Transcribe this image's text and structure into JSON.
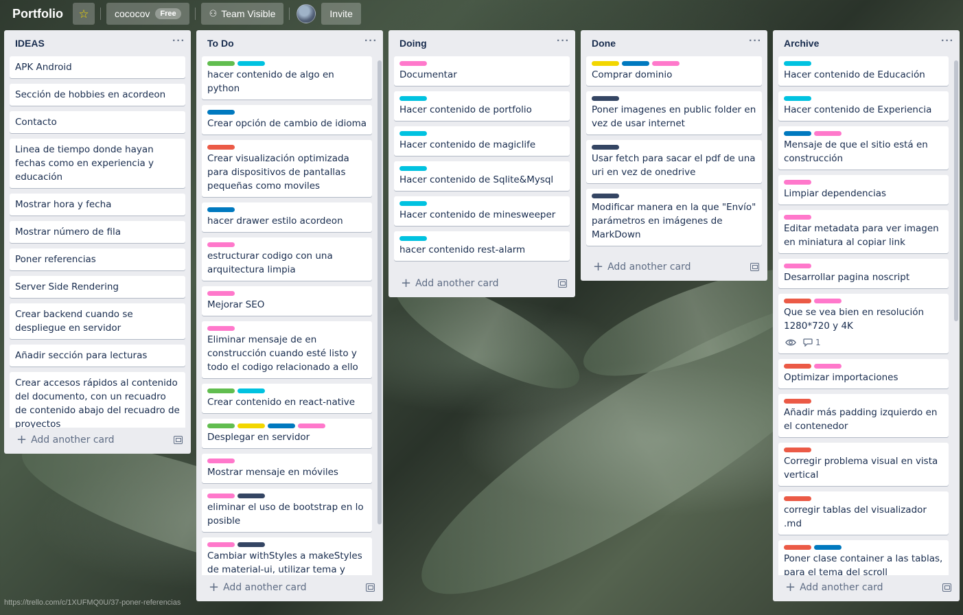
{
  "header": {
    "board_title": "Portfolio",
    "workspace": "cococov",
    "plan_badge": "Free",
    "visibility": "Team Visible",
    "invite": "Invite"
  },
  "colors": {
    "green": "#61bd4f",
    "yellow": "#f2d600",
    "red": "#eb5a46",
    "blue": "#0079bf",
    "sky": "#00c2e0",
    "pink": "#ff78cb",
    "navy": "#344563"
  },
  "add_card_label": "Add another card",
  "status_url": "https://trello.com/c/1XUFMQ0U/37-poner-referencias",
  "lists": [
    {
      "title": "IDEAS",
      "cards": [
        {
          "text": "APK Android",
          "labels": []
        },
        {
          "text": "Sección de hobbies en acordeon",
          "labels": []
        },
        {
          "text": "Contacto",
          "labels": []
        },
        {
          "text": "Linea de tiempo donde hayan fechas como en experiencia y educación",
          "labels": []
        },
        {
          "text": "Mostrar hora y fecha",
          "labels": []
        },
        {
          "text": "Mostrar número de fila",
          "labels": []
        },
        {
          "text": "Poner referencias",
          "labels": []
        },
        {
          "text": "Server Side Rendering",
          "labels": []
        },
        {
          "text": "Crear backend cuando se despliegue en servidor",
          "labels": []
        },
        {
          "text": "Añadir sección para lecturas",
          "labels": []
        },
        {
          "text": "Crear accesos rápidos al contenido del documento, con un recuadro de contenido abajo del recuadro de proyectos",
          "labels": []
        }
      ]
    },
    {
      "title": "To Do",
      "cards": [
        {
          "text": "hacer contenido de algo en python",
          "labels": [
            "green",
            "sky"
          ]
        },
        {
          "text": "Crear opción de cambio de idioma",
          "labels": [
            "blue"
          ]
        },
        {
          "text": "Crear visualización optimizada para dispositivos de pantallas pequeñas como moviles",
          "labels": [
            "red"
          ]
        },
        {
          "text": "hacer drawer estilo acordeon",
          "labels": [
            "blue"
          ]
        },
        {
          "text": "estructurar codigo con una arquitectura limpia",
          "labels": [
            "pink"
          ]
        },
        {
          "text": "Mejorar SEO",
          "labels": [
            "pink"
          ]
        },
        {
          "text": "Eliminar mensaje de en construcción cuando esté listo y todo el codigo relacionado a ello",
          "labels": [
            "pink"
          ]
        },
        {
          "text": "Crear contenido en react-native",
          "labels": [
            "green",
            "sky"
          ]
        },
        {
          "text": "Desplegar en servidor",
          "labels": [
            "green",
            "yellow",
            "blue",
            "pink"
          ]
        },
        {
          "text": "Mostrar mensaje en móviles",
          "labels": [
            "pink"
          ]
        },
        {
          "text": "eliminar el uso de bootstrap en lo posible",
          "labels": [
            "pink",
            "navy"
          ]
        },
        {
          "text": "Cambiar withStyles a makeStyles de material-ui, utilizar tema y separar",
          "labels": [
            "pink",
            "navy"
          ]
        }
      ]
    },
    {
      "title": "Doing",
      "cards": [
        {
          "text": "Documentar",
          "labels": [
            "pink"
          ]
        },
        {
          "text": "Hacer contenido de portfolio",
          "labels": [
            "sky"
          ]
        },
        {
          "text": "Hacer contenido de magiclife",
          "labels": [
            "sky"
          ]
        },
        {
          "text": "Hacer contenido de Sqlite&Mysql",
          "labels": [
            "sky"
          ]
        },
        {
          "text": "Hacer contenido de minesweeper",
          "labels": [
            "sky"
          ]
        },
        {
          "text": "hacer contenido rest-alarm",
          "labels": [
            "sky"
          ]
        }
      ]
    },
    {
      "title": "Done",
      "cards": [
        {
          "text": "Comprar dominio",
          "labels": [
            "yellow",
            "blue",
            "pink"
          ]
        },
        {
          "text": "Poner imagenes en public folder en vez de usar internet",
          "labels": [
            "navy"
          ]
        },
        {
          "text": "Usar fetch para sacar el pdf de una uri en vez de onedrive",
          "labels": [
            "navy"
          ]
        },
        {
          "text": "Modificar manera en la que \"Envío\" parámetros en imágenes de MarkDown",
          "labels": [
            "navy"
          ]
        }
      ]
    },
    {
      "title": "Archive",
      "cards": [
        {
          "text": "Hacer contenido de Educación",
          "labels": [
            "sky"
          ]
        },
        {
          "text": "Hacer contenido de Experiencia",
          "labels": [
            "sky"
          ]
        },
        {
          "text": "Mensaje de que el sitio está en construcción",
          "labels": [
            "blue",
            "pink"
          ]
        },
        {
          "text": "Limpiar dependencias",
          "labels": [
            "pink"
          ]
        },
        {
          "text": "Editar metadata para ver imagen en miniatura al copiar link",
          "labels": [
            "pink"
          ]
        },
        {
          "text": "Desarrollar pagina noscript",
          "labels": [
            "pink"
          ]
        },
        {
          "text": "Que se vea bien en resolución 1280*720 y 4K",
          "labels": [
            "red",
            "pink"
          ],
          "badges": {
            "watching": true,
            "comments": "1"
          }
        },
        {
          "text": "Optimizar importaciones",
          "labels": [
            "red",
            "pink"
          ]
        },
        {
          "text": "Añadir más padding izquierdo en el contenedor",
          "labels": [
            "red"
          ]
        },
        {
          "text": "Corregir problema visual en vista vertical",
          "labels": [
            "red"
          ]
        },
        {
          "text": "corregir tablas del visualizador .md",
          "labels": [
            "red"
          ]
        },
        {
          "text": "Poner clase container a las tablas, para el tema del scroll",
          "labels": [
            "red",
            "blue"
          ]
        }
      ]
    }
  ]
}
